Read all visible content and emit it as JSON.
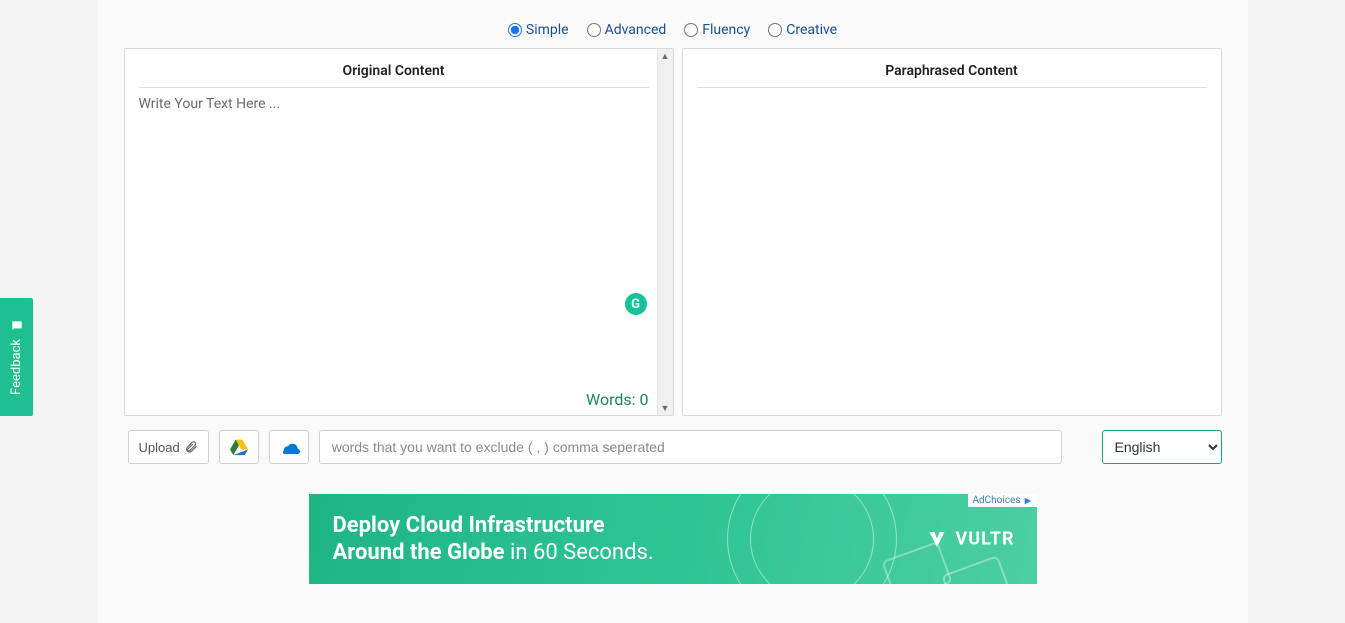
{
  "modes": {
    "simple": "Simple",
    "advanced": "Advanced",
    "fluency": "Fluency",
    "creative": "Creative",
    "selected": "simple"
  },
  "panels": {
    "original_title": "Original Content",
    "paraphrased_title": "Paraphrased Content",
    "original_placeholder": "Write Your Text Here ...",
    "word_count_label": "Words: 0"
  },
  "bottom": {
    "upload_label": "Upload",
    "exclude_placeholder": "words that you want to exclude ( , ) comma seperated",
    "language": "English"
  },
  "ad": {
    "line1": "Deploy Cloud Infrastructure",
    "line2a": "Around the Globe",
    "line2b": " in 60 Seconds.",
    "brand": "VULTR",
    "adchoices": "AdChoices"
  },
  "sidebar": {
    "feedback": "Feedback"
  },
  "grammar_badge": "G"
}
